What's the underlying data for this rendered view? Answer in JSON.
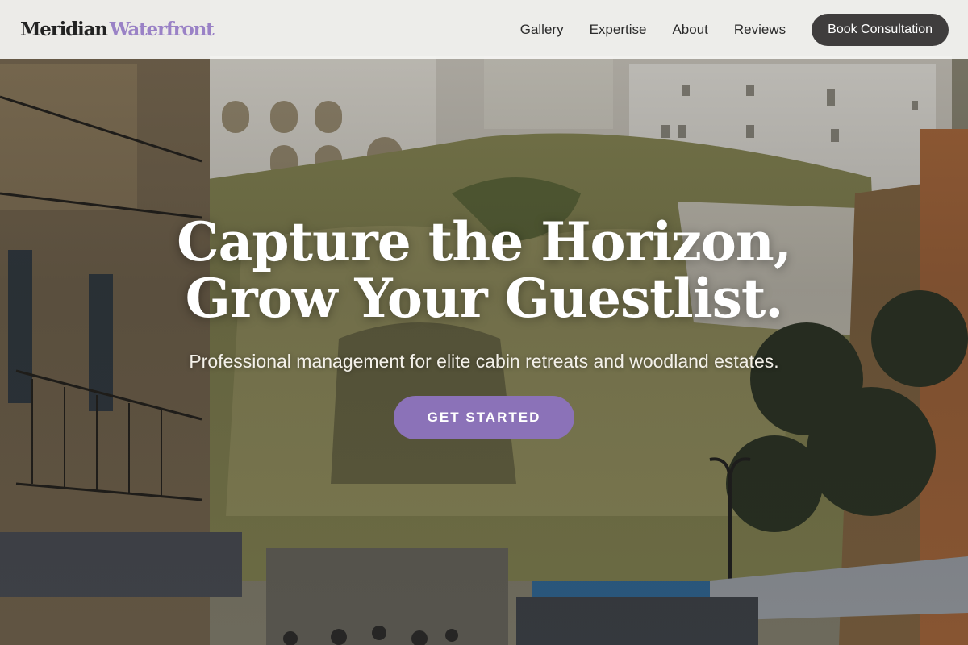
{
  "brand": {
    "name_part1": "Meridian",
    "name_part2": "Waterfront"
  },
  "nav": {
    "links": [
      "Gallery",
      "Expertise",
      "About",
      "Reviews"
    ],
    "cta_label": "Book Consultation"
  },
  "hero": {
    "title_line1": "Capture the Horizon,",
    "title_line2": "Grow Your Guestlist.",
    "subtitle": "Professional management for elite cabin retreats and woodland estates.",
    "button_label": "GET STARTED"
  },
  "colors": {
    "accent": "#8b72b8",
    "brand_accent": "#9a82c6",
    "nav_bg": "#f6f6f4",
    "cta_bg": "#3f3d3d"
  }
}
